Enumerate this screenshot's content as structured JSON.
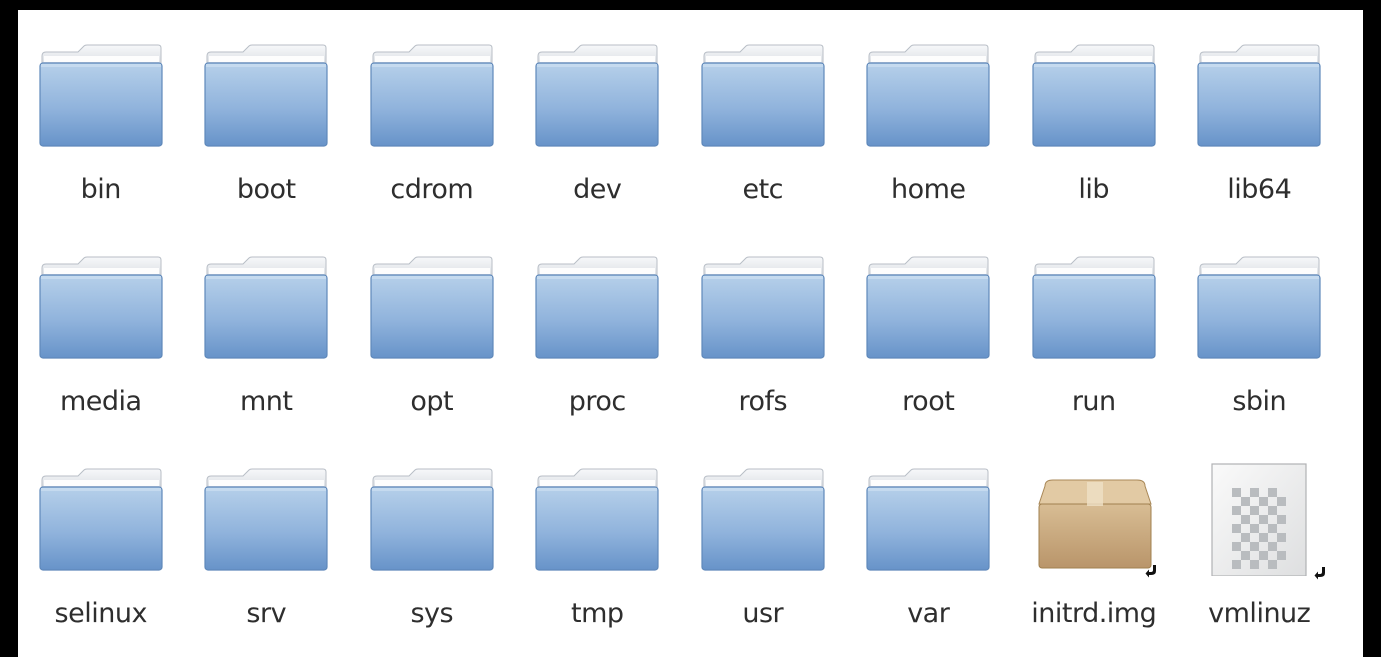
{
  "files": [
    {
      "name": "bin",
      "type": "folder",
      "icon": "folder-icon"
    },
    {
      "name": "boot",
      "type": "folder",
      "icon": "folder-icon"
    },
    {
      "name": "cdrom",
      "type": "folder",
      "icon": "folder-icon"
    },
    {
      "name": "dev",
      "type": "folder",
      "icon": "folder-icon"
    },
    {
      "name": "etc",
      "type": "folder",
      "icon": "folder-icon"
    },
    {
      "name": "home",
      "type": "folder",
      "icon": "folder-icon"
    },
    {
      "name": "lib",
      "type": "folder",
      "icon": "folder-icon"
    },
    {
      "name": "lib64",
      "type": "folder",
      "icon": "folder-icon"
    },
    {
      "name": "media",
      "type": "folder",
      "icon": "folder-icon"
    },
    {
      "name": "mnt",
      "type": "folder",
      "icon": "folder-icon"
    },
    {
      "name": "opt",
      "type": "folder",
      "icon": "folder-icon"
    },
    {
      "name": "proc",
      "type": "folder",
      "icon": "folder-icon"
    },
    {
      "name": "rofs",
      "type": "folder",
      "icon": "folder-icon"
    },
    {
      "name": "root",
      "type": "folder",
      "icon": "folder-icon"
    },
    {
      "name": "run",
      "type": "folder",
      "icon": "folder-icon"
    },
    {
      "name": "sbin",
      "type": "folder",
      "icon": "folder-icon"
    },
    {
      "name": "selinux",
      "type": "folder",
      "icon": "folder-icon"
    },
    {
      "name": "srv",
      "type": "folder",
      "icon": "folder-icon"
    },
    {
      "name": "sys",
      "type": "folder",
      "icon": "folder-icon"
    },
    {
      "name": "tmp",
      "type": "folder",
      "icon": "folder-icon"
    },
    {
      "name": "usr",
      "type": "folder",
      "icon": "folder-icon"
    },
    {
      "name": "var",
      "type": "folder",
      "icon": "folder-icon"
    },
    {
      "name": "initrd.img",
      "type": "symlink",
      "icon": "package-icon"
    },
    {
      "name": "vmlinuz",
      "type": "symlink",
      "icon": "binary-file-icon"
    }
  ],
  "colors": {
    "background": "#ffffff",
    "label": "#2e2e2e",
    "folder_top": "#aecbe7",
    "folder_bottom": "#6c9bd0",
    "folder_tab": "#eef1f4",
    "package": "#c9a77b"
  }
}
